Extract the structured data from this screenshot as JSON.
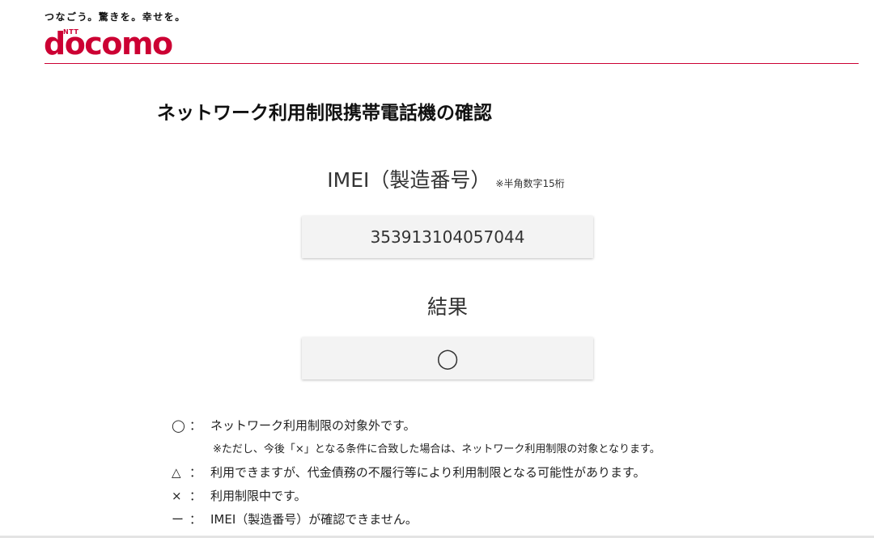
{
  "header": {
    "tagline": "つなごう。驚きを。幸せを。",
    "logo_ntt": "NTT",
    "logo_text": "docomo",
    "brand_color": "#cc0033"
  },
  "main": {
    "title": "ネットワーク利用制限携帯電話機の確認",
    "imei_label": "IMEI（製造番号）",
    "imei_note": "※半角数字15桁",
    "imei_value": "353913104057044",
    "result_label": "結果",
    "result_value": "◯"
  },
  "legend": {
    "items": [
      {
        "symbol": "◯",
        "colon": "：",
        "text": "ネットワーク利用制限の対象外です。"
      },
      {
        "symbol": "△",
        "colon": "：",
        "text": "利用できますが、代金債務の不履行等により利用制限となる可能性があります。"
      },
      {
        "symbol": "×",
        "colon": "：",
        "text": "利用制限中です。"
      },
      {
        "symbol": "ー",
        "colon": "：",
        "text": "IMEI（製造番号）が確認できません。"
      }
    ],
    "note": "※ただし、今後「×」となる条件に合致した場合は、ネットワーク利用制限の対象となります。"
  }
}
